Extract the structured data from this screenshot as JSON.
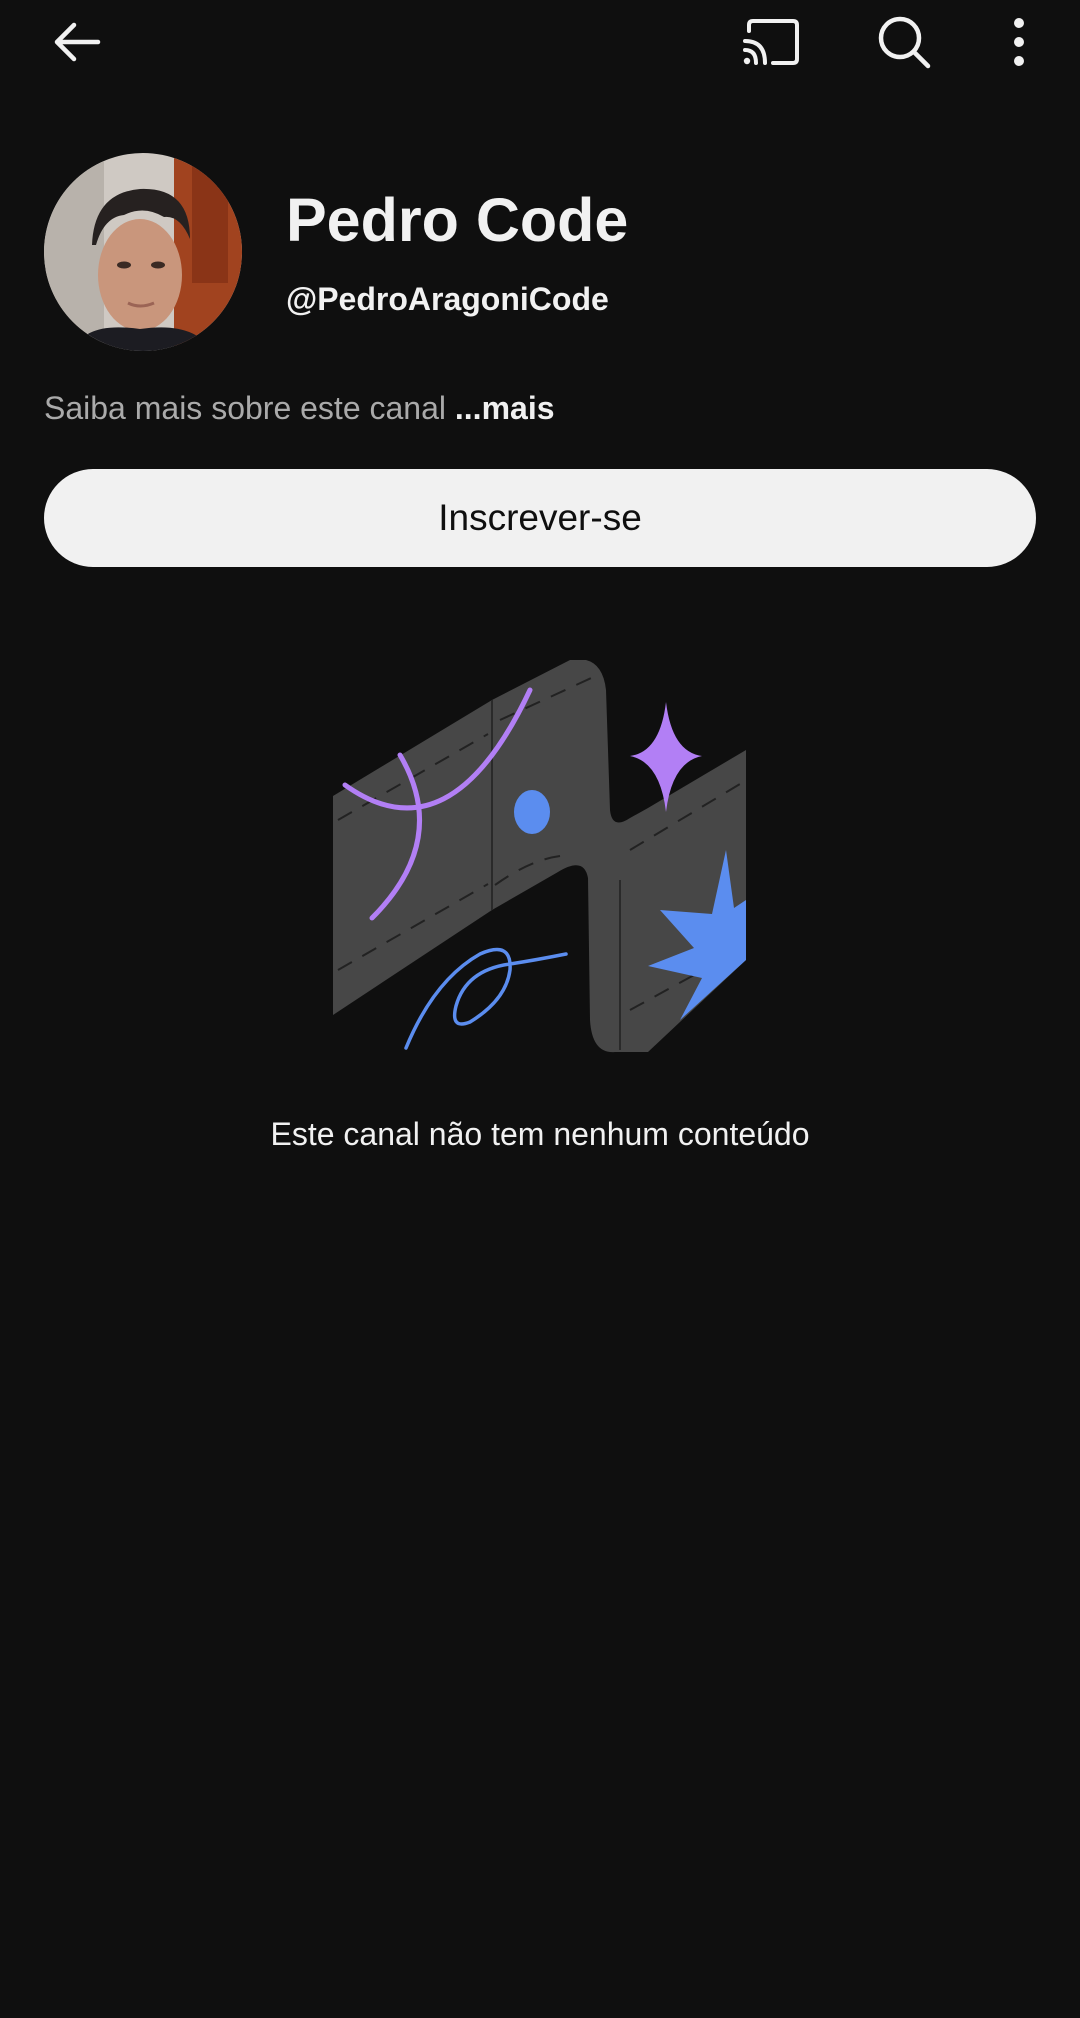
{
  "header": {
    "icons": [
      "back-arrow-icon",
      "cast-icon",
      "search-icon",
      "more-vert-icon"
    ]
  },
  "channel": {
    "name": "Pedro Code",
    "handle": "@PedroAragoniCode",
    "about_text": "Saiba mais sobre este canal",
    "about_more": "...mais",
    "subscribe_label": "Inscrever-se"
  },
  "empty_state": {
    "message": "Este canal não tem nenhum conteúdo"
  },
  "colors": {
    "background": "#0f0f0f",
    "text_primary": "#f1f1f1",
    "text_secondary": "#aaaaaa",
    "button_bg": "#f1f1f1",
    "illustration_purple": "#b27ff5",
    "illustration_blue": "#5b8def"
  }
}
